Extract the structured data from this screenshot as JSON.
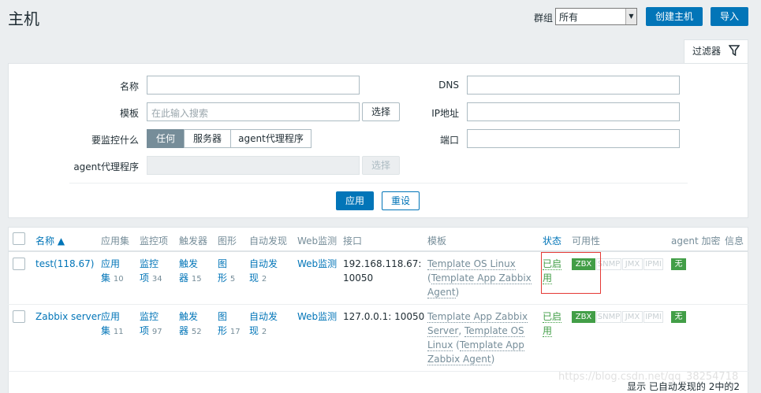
{
  "header": {
    "title": "主机",
    "group_label": "群组",
    "group_value": "所有",
    "create_button": "创建主机",
    "import_button": "导入"
  },
  "filter": {
    "tab_label": "过滤器",
    "name_label": "名称",
    "name_value": "",
    "template_label": "模板",
    "template_placeholder": "在此输入搜索",
    "select_button": "选择",
    "monitor_label": "要监控什么",
    "monitor_options": [
      "任何",
      "服务器",
      "agent代理程序"
    ],
    "monitor_selected": "任何",
    "proxy_label": "agent代理程序",
    "proxy_select_button": "选择",
    "dns_label": "DNS",
    "ip_label": "IP地址",
    "port_label": "端口",
    "apply_button": "应用",
    "reset_button": "重设"
  },
  "table": {
    "columns": {
      "name": "名称 ▲",
      "applications": "应用集",
      "items": "监控项",
      "triggers": "触发器",
      "graphs": "图形",
      "discovery": "自动发现",
      "web": "Web监测",
      "interface": "接口",
      "templates": "模板",
      "status": "状态",
      "availability": "可用性",
      "encryption": "agent 加密",
      "info": "信息"
    },
    "rows": [
      {
        "name": "test(118.67)",
        "app_a": "应用",
        "app_b": "集",
        "app_count": "10",
        "items_a": "监控",
        "items_b": "项",
        "items_count": "34",
        "trig_a": "触发",
        "trig_b": "器",
        "trig_count": "15",
        "graph_a": "图",
        "graph_b": "形",
        "graph_count": "5",
        "disc_a": "自动发",
        "disc_b": "现",
        "disc_count": "2",
        "web": "Web监测",
        "iface_a": "192.168.118.67:",
        "iface_b": "10050",
        "tpl_1": "Template OS Linux",
        "tpl_2": "Template App Zabbix",
        "tpl_3": "Agent",
        "status_a": "已启",
        "status_b": "用",
        "avail": [
          "ZBX",
          "SNMP",
          "JMX",
          "IPMI"
        ],
        "encryption": "无"
      },
      {
        "name": "Zabbix server",
        "app_a": "应用",
        "app_b": "集",
        "app_count": "11",
        "items_a": "监控",
        "items_b": "项",
        "items_count": "97",
        "trig_a": "触发",
        "trig_b": "器",
        "trig_count": "52",
        "graph_a": "图",
        "graph_b": "形",
        "graph_count": "17",
        "disc_a": "自动发",
        "disc_b": "现",
        "disc_count": "2",
        "web": "Web监测",
        "iface_a": "127.0.0.1: 10050",
        "tpl_1": "Template App Zabbix",
        "tpl_2": "Server",
        "tpl_3": "Template OS",
        "tpl_4": "Linux",
        "tpl_5": "Template App",
        "tpl_6": "Zabbix Agent",
        "status_a": "已启",
        "status_b": "用",
        "avail": [
          "ZBX",
          "SNMP",
          "JMX",
          "IPMI"
        ],
        "encryption": "无"
      }
    ]
  },
  "footer": {
    "summary": "显示 已自动发现的 2中的2",
    "watermark": "https://blog.csdn.net/qq_38254718"
  },
  "colors": {
    "primary": "#0275b8",
    "green": "#429e47",
    "highlight": "#e53935"
  }
}
